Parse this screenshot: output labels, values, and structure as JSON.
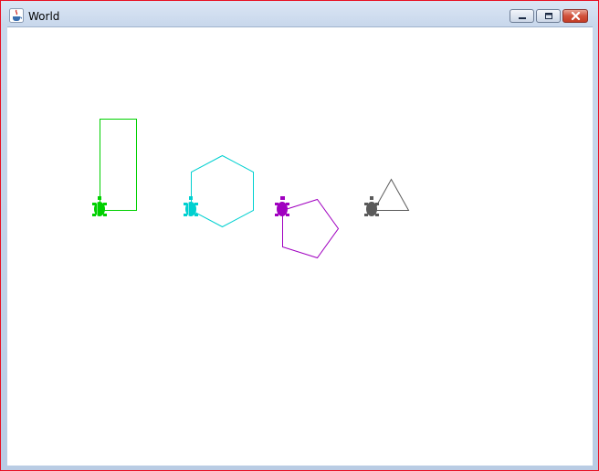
{
  "window": {
    "title": "World",
    "controls": {
      "minimize": "minimize-icon",
      "maximize": "maximize-icon",
      "close": "close-icon"
    }
  },
  "colors": {
    "frame_border": "#e81123",
    "canvas_bg": "#ffffff",
    "green": "#00d000",
    "cyan": "#00d0d0",
    "purple": "#a000c0",
    "gray": "#5a5a5a"
  },
  "world": {
    "turtles": [
      {
        "name": "green-turtle",
        "color": "#00d000",
        "shape": "rectangle"
      },
      {
        "name": "cyan-turtle",
        "color": "#00d0d0",
        "shape": "hexagon"
      },
      {
        "name": "purple-turtle",
        "color": "#a000c0",
        "shape": "pentagon"
      },
      {
        "name": "gray-turtle",
        "color": "#5a5a5a",
        "shape": "triangle"
      }
    ]
  }
}
